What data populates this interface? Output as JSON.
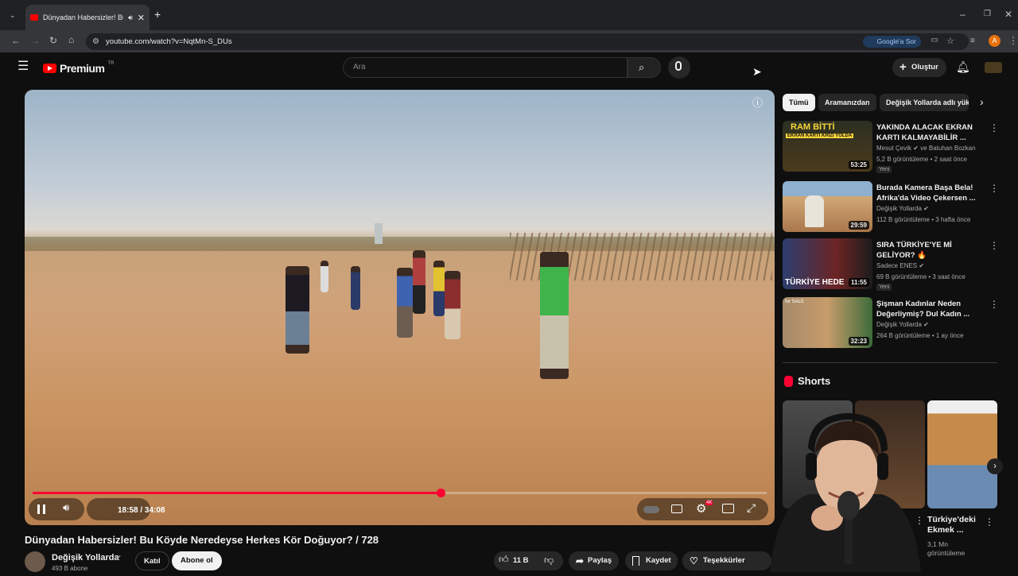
{
  "browser": {
    "tab_title": "Dünyadan Habersizler! Bu K",
    "url": "youtube.com/watch?v=NqtMn-S_DUs",
    "google_sor": "Google'a Sor",
    "profile_initial": "A"
  },
  "youtube": {
    "logo_text": "Premium",
    "logo_region": "TR",
    "search_placeholder": "Ara",
    "create_label": "Oluştur"
  },
  "player": {
    "time_current": "18:58",
    "time_total": "34:08",
    "time_display": "18:58 / 34:08",
    "progress": 0.556,
    "hd_badge": "4K"
  },
  "video": {
    "title": "Dünyadan Habersizler! Bu Köyde Neredeyse Herkes Kör Doğuyor? / 728",
    "channel_name": "Değişik Yollarda",
    "subscribers": "493 B abone",
    "join_label": "Katıl",
    "subscribe_label": "Abone ol",
    "likes": "11 B",
    "share_label": "Paylaş",
    "save_label": "Kaydet",
    "thanks_label": "Teşekkürler"
  },
  "sidebar": {
    "chips": [
      "Tümü",
      "Aramanızdan",
      "Değişik Yollarda adlı yük"
    ],
    "recommendations": [
      {
        "title": "YAKINDA ALACAK EKRAN KARTI KALMAYABİLİR ...",
        "channel": "Mesut Çevik",
        "channel_extra": "ve Batuhan Bozkan",
        "meta": "5,2 B görüntüleme • 2 saat önce",
        "badge": "Yeni",
        "duration": "53:25",
        "thumb_text": "RAM BİTTİ",
        "thumb_sub": "EKRAN KARTI KRİZİ YOLDA"
      },
      {
        "title": "Burada Kamera Başa Bela! Afrika'da Video Çekersen ...",
        "channel": "Değişik Yollarda",
        "channel_extra": "",
        "meta": "112 B görüntüleme • 3 hafta önce",
        "badge": "",
        "duration": "29:59",
        "thumb_text": "",
        "thumb_sub": ""
      },
      {
        "title": "SIRA TÜRKİYE'YE Mİ GELİYOR? 🔥",
        "channel": "Sadece ENES",
        "channel_extra": "",
        "meta": "69 B görüntüleme • 3 saat önce",
        "badge": "Yeni",
        "duration": "11:55",
        "thumb_text": "TÜRKİYE HEDE",
        "thumb_sub": ""
      },
      {
        "title": "Şişman Kadınlar Neden Değerliymiş? Dul Kadın ...",
        "channel": "Değişik Yollarda",
        "channel_extra": "",
        "meta": "264 B görüntüleme • 1 ay önce",
        "badge": "",
        "duration": "32:23",
        "thumb_text": "",
        "thumb_sub": "for SALE"
      }
    ],
    "shorts_heading": "Shorts",
    "shorts": [
      {
        "title": "Türkiye'deki Ekmek ...",
        "views": "3,1 Mn görüntüleme"
      }
    ]
  },
  "colors": {
    "accent": "#ff0033",
    "background": "#0f0f0f",
    "chip_active_bg": "#f1f1f1"
  }
}
